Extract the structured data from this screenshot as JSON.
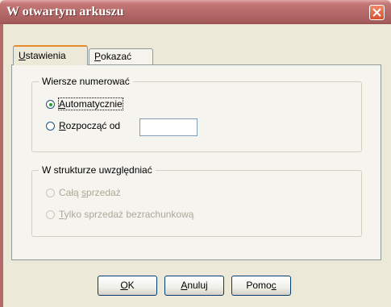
{
  "window": {
    "title": "W otwartym arkuszu"
  },
  "tabs": [
    {
      "label_accel": "U",
      "label_rest": "stawienia",
      "active": true
    },
    {
      "label_accel": "P",
      "label_rest": "okazać",
      "active": false
    }
  ],
  "group_numbering": {
    "legend": "Wiersze numerować",
    "options": [
      {
        "accel": "A",
        "rest": "utomatycznie",
        "checked": true
      },
      {
        "accel": "R",
        "rest": "ozpocząć od",
        "checked": false
      }
    ],
    "start_value": ""
  },
  "group_structure": {
    "legend": "W strukturze uwzględniać",
    "options": [
      {
        "pre": "Całą ",
        "accel": "s",
        "rest": "przedaż",
        "enabled": false
      },
      {
        "pre": "",
        "accel": "T",
        "rest": "ylko sprzedaż bezrachunkową",
        "enabled": false
      }
    ]
  },
  "buttons": {
    "ok": {
      "pre": "",
      "accel": "O",
      "rest": "K"
    },
    "cancel": {
      "pre": "",
      "accel": "A",
      "rest": "nuluj"
    },
    "help": {
      "pre": "Pomo",
      "accel": "c",
      "rest": ""
    }
  },
  "colors": {
    "titlebar": "#b56a6a",
    "window_bg": "#ece9d8",
    "close_button": "#d4502e",
    "tab_highlight": "#e68b2c"
  }
}
